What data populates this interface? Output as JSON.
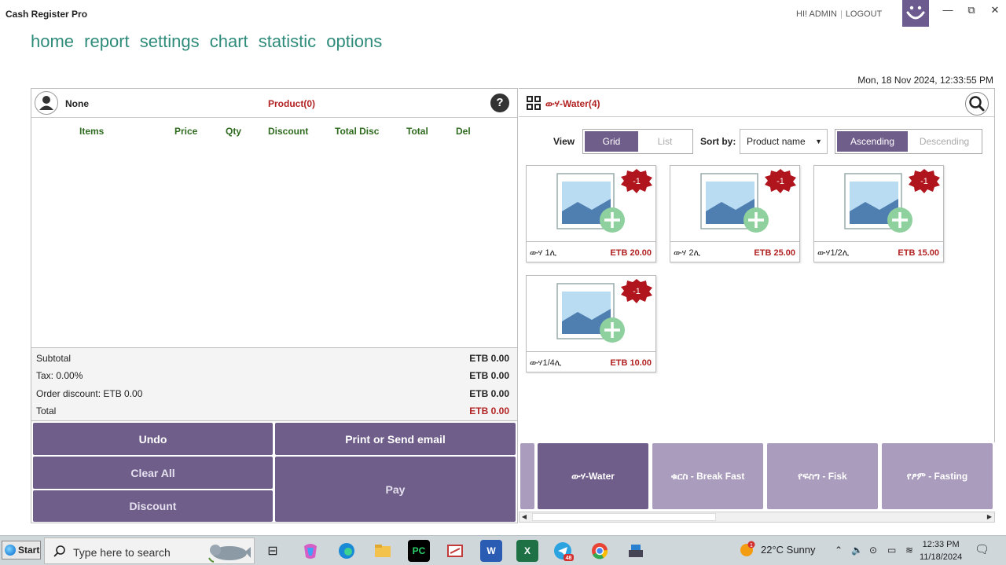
{
  "app": {
    "title": "Cash Register Pro",
    "greeting": "HI! ADMIN",
    "logout": "LOGOUT"
  },
  "window_controls": {
    "minimize": "—",
    "restore": "⧉",
    "close": "✕"
  },
  "nav": [
    "home",
    "report",
    "settings",
    "chart",
    "statistic",
    "options"
  ],
  "datetime": "Mon, 18 Nov 2024, 12:33:55 PM",
  "order": {
    "customer": "None",
    "product_count": "Product(0)",
    "help": "?",
    "columns": [
      "Items",
      "Price",
      "Qty",
      "Discount",
      "Total Disc",
      "Total",
      "Del"
    ],
    "subtotal_label": "Subtotal",
    "subtotal": "ETB 0.00",
    "tax_label": "Tax: 0.00%",
    "tax": "ETB 0.00",
    "order_discount_label": "Order discount: ETB 0.00",
    "order_discount": "ETB 0.00",
    "total_label": "Total",
    "total": "ETB 0.00"
  },
  "actions": {
    "undo": "Undo",
    "print": "Print or Send email",
    "clear_all": "Clear All",
    "pay": "Pay",
    "discount": "Discount"
  },
  "catalog": {
    "category_title": "ውሃ-Water(4)",
    "view_label": "View",
    "view_grid": "Grid",
    "view_list": "List",
    "sort_label": "Sort by:",
    "sort_value": "Product name",
    "ascending": "Ascending",
    "descending": "Descending",
    "products": [
      {
        "name": "ውሃ 1ሊ",
        "price": "ETB 20.00",
        "badge": "-1"
      },
      {
        "name": "ውሃ 2ሊ",
        "price": "ETB 25.00",
        "badge": "-1"
      },
      {
        "name": "ውሃ1/2ሊ",
        "price": "ETB 15.00",
        "badge": "-1"
      },
      {
        "name": "ውሃ1/4ሊ",
        "price": "ETB 10.00",
        "badge": "-1"
      }
    ],
    "categories": [
      "ውሃ-Water",
      "ቁርስ - Break Fast",
      "የፍስግ - Fisk",
      "የፆም - Fasting"
    ]
  },
  "taskbar": {
    "start": "Start",
    "search_placeholder": "Type here to search",
    "weather_badge": "1",
    "weather": "22°C  Sunny",
    "time": "12:33 PM",
    "date": "11/18/2024",
    "telegram_badge": "48",
    "pycharm": "PC",
    "word": "W",
    "excel": "X"
  },
  "colors": {
    "accent": "#6f5d8a",
    "accent_light": "#a99cbc",
    "nav": "#2e8b7a",
    "price_red": "#b22222",
    "column_green": "#2e6b1e"
  }
}
